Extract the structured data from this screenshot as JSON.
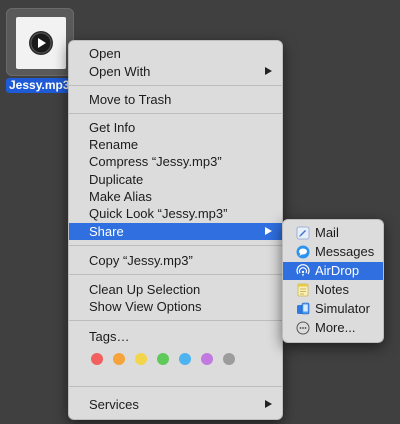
{
  "desktop": {
    "file_name": "Jessy.mp3"
  },
  "menu": {
    "group1": [
      {
        "label": "Open"
      },
      {
        "label": "Open With"
      }
    ],
    "group2": [
      {
        "label": "Move to Trash"
      }
    ],
    "group3": [
      {
        "label": "Get Info"
      },
      {
        "label": "Rename"
      },
      {
        "label": "Compress “Jessy.mp3”"
      },
      {
        "label": "Duplicate"
      },
      {
        "label": "Make Alias"
      },
      {
        "label": "Quick Look “Jessy.mp3”"
      },
      {
        "label": "Share"
      }
    ],
    "group4": [
      {
        "label": "Copy “Jessy.mp3”"
      }
    ],
    "group5": [
      {
        "label": "Clean Up Selection"
      },
      {
        "label": "Show View Options"
      }
    ],
    "tags_label": "Tags…",
    "tag_colors": [
      "#f15f5f",
      "#f5a33a",
      "#f3d54b",
      "#5fc95a",
      "#4db3f1",
      "#c27ae0",
      "#9c9c9c"
    ],
    "services_label": "Services",
    "selected_item": "Share",
    "accent_color": "#2f6fe0"
  },
  "share_submenu": {
    "items": [
      {
        "label": "Mail",
        "icon": "mail-icon"
      },
      {
        "label": "Messages",
        "icon": "messages-icon"
      },
      {
        "label": "AirDrop",
        "icon": "airdrop-icon"
      },
      {
        "label": "Notes",
        "icon": "notes-icon"
      },
      {
        "label": "Simulator",
        "icon": "simulator-icon"
      },
      {
        "label": "More...",
        "icon": "more-icon"
      }
    ],
    "selected_item": "AirDrop"
  }
}
